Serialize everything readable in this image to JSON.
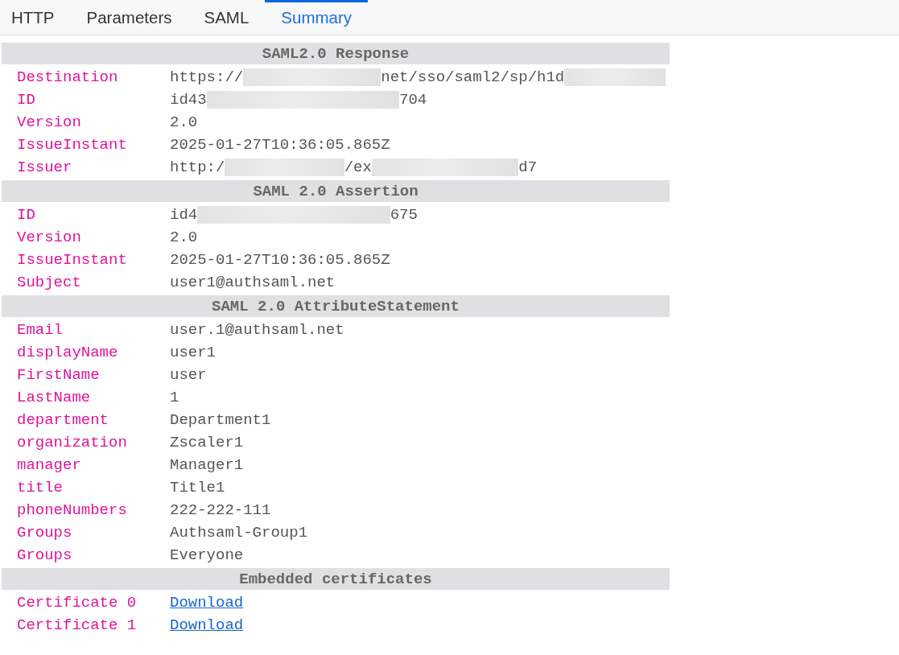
{
  "tabs": [
    {
      "label": "HTTP",
      "selected": false
    },
    {
      "label": "Parameters",
      "selected": false
    },
    {
      "label": "SAML",
      "selected": false
    },
    {
      "label": "Summary",
      "selected": true
    }
  ],
  "sections": [
    {
      "title": "SAML2.0 Response",
      "rows": [
        {
          "label": "Destination",
          "value": [
            {
              "kind": "text",
              "text": "https://"
            },
            {
              "kind": "redacted"
            },
            {
              "kind": "text",
              "text": "net/sso/saml2/sp/h1d"
            },
            {
              "kind": "redacted"
            }
          ]
        },
        {
          "label": "ID",
          "value": [
            {
              "kind": "text",
              "text": "id43"
            },
            {
              "kind": "redacted"
            },
            {
              "kind": "text",
              "text": "704"
            }
          ]
        },
        {
          "label": "Version",
          "value": [
            {
              "kind": "text",
              "text": "2.0"
            }
          ]
        },
        {
          "label": "IssueInstant",
          "value": [
            {
              "kind": "text",
              "text": "2025-01-27T10:36:05.865Z"
            }
          ]
        },
        {
          "label": "Issuer",
          "value": [
            {
              "kind": "text",
              "text": "http:/"
            },
            {
              "kind": "redacted"
            },
            {
              "kind": "text",
              "text": "/ex"
            },
            {
              "kind": "redacted"
            },
            {
              "kind": "text",
              "text": "d7"
            }
          ]
        }
      ]
    },
    {
      "title": "SAML 2.0 Assertion",
      "rows": [
        {
          "label": "ID",
          "value": [
            {
              "kind": "text",
              "text": "id4"
            },
            {
              "kind": "redacted"
            },
            {
              "kind": "text",
              "text": "675"
            }
          ]
        },
        {
          "label": "Version",
          "value": [
            {
              "kind": "text",
              "text": "2.0"
            }
          ]
        },
        {
          "label": "IssueInstant",
          "value": [
            {
              "kind": "text",
              "text": "2025-01-27T10:36:05.865Z"
            }
          ]
        },
        {
          "label": "Subject",
          "value": [
            {
              "kind": "text",
              "text": "user1@authsaml.net"
            }
          ]
        }
      ]
    },
    {
      "title": "SAML 2.0 AttributeStatement",
      "rows": [
        {
          "label": "Email",
          "value": [
            {
              "kind": "text",
              "text": "user.1@authsaml.net"
            }
          ]
        },
        {
          "label": "displayName",
          "value": [
            {
              "kind": "text",
              "text": "user1"
            }
          ]
        },
        {
          "label": "FirstName",
          "value": [
            {
              "kind": "text",
              "text": "user"
            }
          ]
        },
        {
          "label": "LastName",
          "value": [
            {
              "kind": "text",
              "text": "1"
            }
          ]
        },
        {
          "label": "department",
          "value": [
            {
              "kind": "text",
              "text": "Department1"
            }
          ]
        },
        {
          "label": "organization",
          "value": [
            {
              "kind": "text",
              "text": "Zscaler1"
            }
          ]
        },
        {
          "label": "manager",
          "value": [
            {
              "kind": "text",
              "text": "Manager1"
            }
          ]
        },
        {
          "label": "title",
          "value": [
            {
              "kind": "text",
              "text": "Title1"
            }
          ]
        },
        {
          "label": "phoneNumbers",
          "value": [
            {
              "kind": "text",
              "text": "222-222-111"
            }
          ]
        },
        {
          "label": "Groups",
          "value": [
            {
              "kind": "text",
              "text": "Authsaml-Group1"
            }
          ]
        },
        {
          "label": "Groups",
          "value": [
            {
              "kind": "text",
              "text": "Everyone"
            }
          ]
        }
      ]
    },
    {
      "title": "Embedded certificates",
      "rows": [
        {
          "label": "Certificate 0",
          "value": [
            {
              "kind": "link",
              "text": "Download"
            }
          ]
        },
        {
          "label": "Certificate 1",
          "value": [
            {
              "kind": "link",
              "text": "Download"
            }
          ]
        }
      ]
    }
  ]
}
